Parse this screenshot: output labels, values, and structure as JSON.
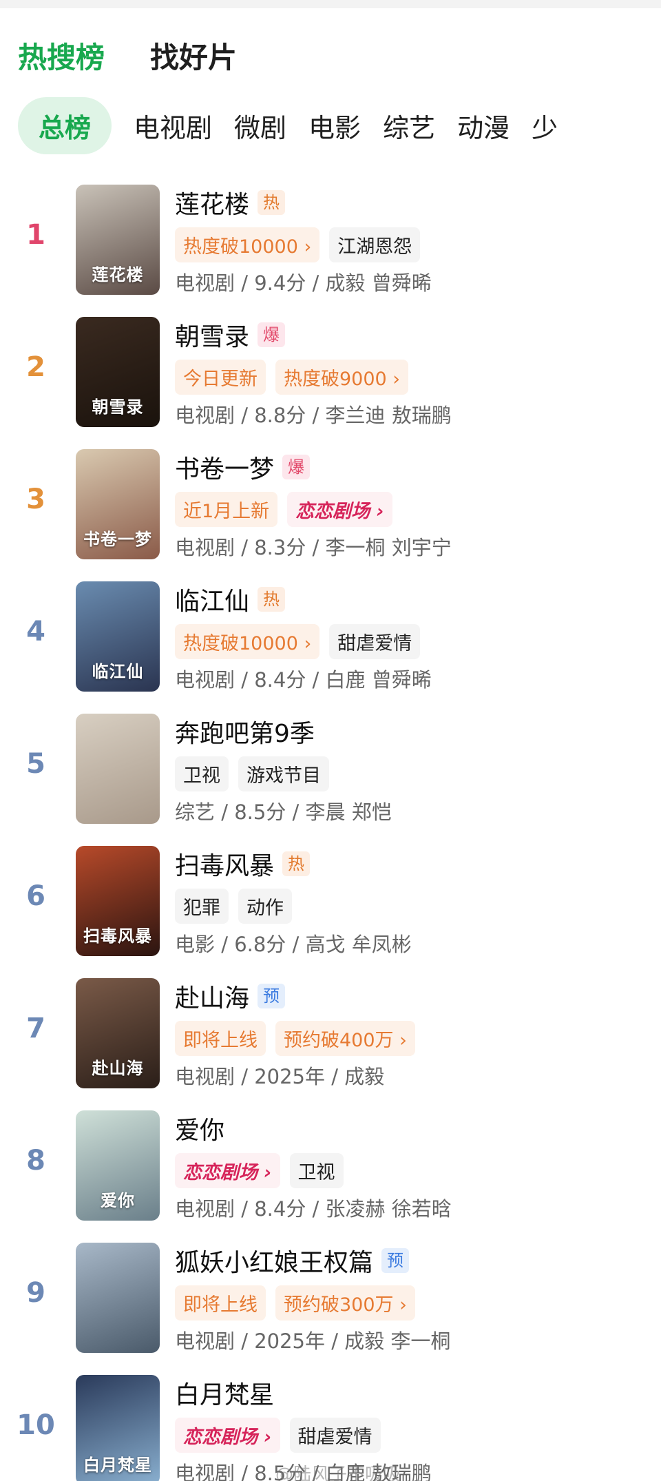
{
  "header": {
    "tabs": [
      {
        "label": "热搜榜",
        "active": true
      },
      {
        "label": "找好片",
        "active": false
      }
    ]
  },
  "categories": [
    {
      "label": "总榜",
      "active": true
    },
    {
      "label": "电视剧"
    },
    {
      "label": "微剧"
    },
    {
      "label": "电影"
    },
    {
      "label": "综艺"
    },
    {
      "label": "动漫"
    },
    {
      "label": "少"
    }
  ],
  "colors": {
    "accent": "#18a84e",
    "rank_top1": "#e0456b",
    "rank_top23": "#e3913a",
    "rank_other": "#6c88b5"
  },
  "items": [
    {
      "rank": "1",
      "title": "莲花楼",
      "badge": "热",
      "badge_type": "hot",
      "poster_text": "莲花楼",
      "tags": [
        {
          "text": "热度破10000 ›",
          "type": "orange"
        },
        {
          "text": "江湖恩怨",
          "type": "gray"
        }
      ],
      "meta": "电视剧 / 9.4分 / 成毅 曾舜晞",
      "poster_colors": [
        "#c9c2b8",
        "#5a4a44"
      ]
    },
    {
      "rank": "2",
      "title": "朝雪录",
      "badge": "爆",
      "badge_type": "boom",
      "poster_text": "朝雪录",
      "tags": [
        {
          "text": "今日更新",
          "type": "orange"
        },
        {
          "text": "热度破9000 ›",
          "type": "orange"
        }
      ],
      "meta": "电视剧 / 8.8分 / 李兰迪 敖瑞鹏",
      "poster_colors": [
        "#3a2a20",
        "#1a120c"
      ]
    },
    {
      "rank": "3",
      "title": "书卷一梦",
      "badge": "爆",
      "badge_type": "boom",
      "poster_text": "书卷一梦",
      "tags": [
        {
          "text": "近1月上新",
          "type": "orange"
        },
        {
          "text": "恋恋剧场 ›",
          "type": "brand"
        }
      ],
      "meta": "电视剧 / 8.3分 / 李一桐 刘宇宁",
      "poster_colors": [
        "#d9c9b0",
        "#8a5a48"
      ]
    },
    {
      "rank": "4",
      "title": "临江仙",
      "badge": "热",
      "badge_type": "hot",
      "poster_text": "临江仙",
      "tags": [
        {
          "text": "热度破10000 ›",
          "type": "orange"
        },
        {
          "text": "甜虐爱情",
          "type": "gray"
        }
      ],
      "meta": "电视剧 / 8.4分 / 白鹿 曾舜晞",
      "poster_colors": [
        "#6a8cb0",
        "#2a3450"
      ]
    },
    {
      "rank": "5",
      "title": "奔跑吧第9季",
      "badge": "",
      "badge_type": "",
      "poster_text": "",
      "tags": [
        {
          "text": "卫视",
          "type": "gray"
        },
        {
          "text": "游戏节目",
          "type": "gray"
        }
      ],
      "meta": "综艺 / 8.5分 / 李晨 郑恺",
      "poster_colors": [
        "#d8cfc2",
        "#a8998a"
      ]
    },
    {
      "rank": "6",
      "title": "扫毒风暴",
      "badge": "热",
      "badge_type": "hot",
      "poster_text": "扫毒风暴",
      "tags": [
        {
          "text": "犯罪",
          "type": "gray"
        },
        {
          "text": "动作",
          "type": "gray"
        }
      ],
      "meta": "电影 / 6.8分 / 高戈 牟凤彬",
      "poster_colors": [
        "#b84a2a",
        "#2a1410"
      ]
    },
    {
      "rank": "7",
      "title": "赴山海",
      "badge": "预",
      "badge_type": "pre",
      "poster_text": "赴山海",
      "tags": [
        {
          "text": "即将上线",
          "type": "orange"
        },
        {
          "text": "预约破400万 ›",
          "type": "orange"
        }
      ],
      "meta": "电视剧 / 2025年 / 成毅",
      "poster_colors": [
        "#7a5a48",
        "#2a1e18"
      ]
    },
    {
      "rank": "8",
      "title": "爱你",
      "badge": "",
      "badge_type": "",
      "poster_text": "爱你",
      "tags": [
        {
          "text": "恋恋剧场 ›",
          "type": "brand"
        },
        {
          "text": "卫视",
          "type": "gray"
        }
      ],
      "meta": "电视剧 / 8.4分 / 张凌赫 徐若晗",
      "poster_colors": [
        "#cfe0d8",
        "#6a7f8a"
      ]
    },
    {
      "rank": "9",
      "title": "狐妖小红娘王权篇",
      "badge": "预",
      "badge_type": "pre",
      "poster_text": "",
      "tags": [
        {
          "text": "即将上线",
          "type": "orange"
        },
        {
          "text": "预约破300万 ›",
          "type": "orange"
        }
      ],
      "meta": "电视剧 / 2025年 / 成毅 李一桐",
      "poster_colors": [
        "#a8b8c8",
        "#4a5a6a"
      ]
    },
    {
      "rank": "10",
      "title": "白月梵星",
      "badge": "",
      "badge_type": "",
      "poster_text": "白月梵星",
      "tags": [
        {
          "text": "恋恋剧场 ›",
          "type": "brand"
        },
        {
          "text": "甜虐爱情",
          "type": "gray"
        }
      ],
      "meta": "电视剧 / 8.5分 / 白鹿 敖瑞鹏",
      "poster_colors": [
        "#2a3a5a",
        "#8ab0d0"
      ]
    }
  ],
  "watermark": "@陆风子不吸吸"
}
